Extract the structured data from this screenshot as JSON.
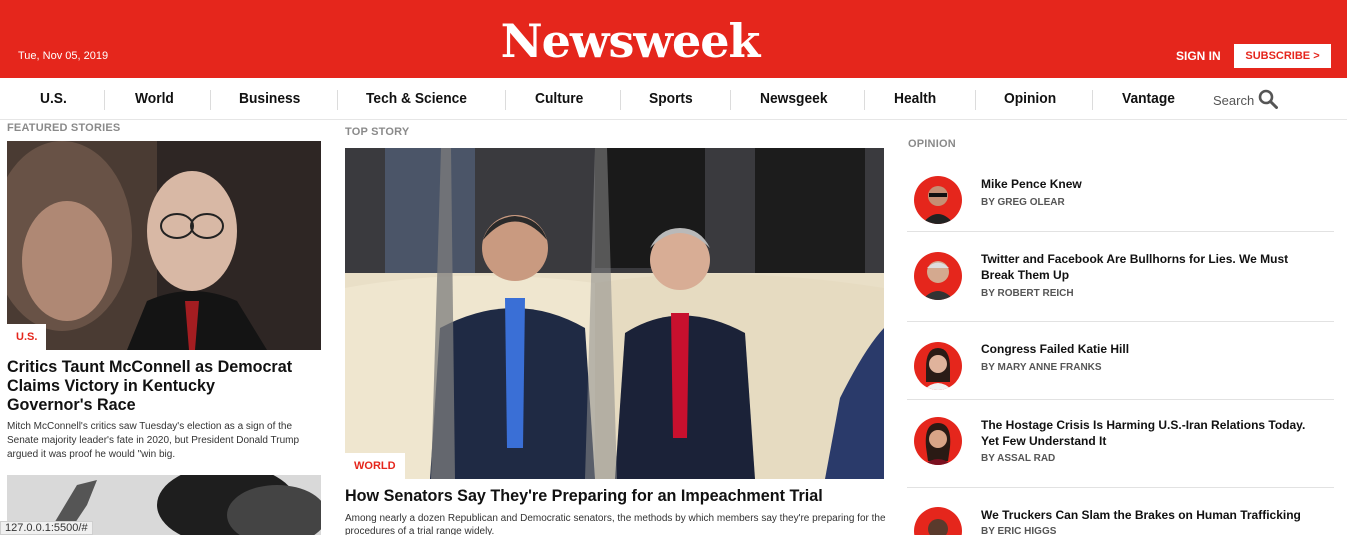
{
  "header": {
    "date": "Tue, Nov 05, 2019",
    "logo": "Newsweek",
    "sign_in": "SIGN IN",
    "subscribe": "SUBSCRIBE >"
  },
  "nav": {
    "items": [
      "U.S.",
      "World",
      "Business",
      "Tech & Science",
      "Culture",
      "Sports",
      "Newsgeek",
      "Health",
      "Opinion",
      "Vantage"
    ],
    "search_label": "Search"
  },
  "featured": {
    "label": "FEATURED STORIES",
    "badge": "U.S.",
    "title": "Critics Taunt McConnell as Democrat Claims Victory in Kentucky Governor's Race",
    "desc": "Mitch McConnell's critics saw Tuesday's election as a sign of the Senate majority leader's fate in 2020, but President Donald Trump argued it was proof he would \"win big."
  },
  "top_story": {
    "label": "TOP STORY",
    "badge": "WORLD",
    "title": "How Senators Say They're Preparing for an Impeachment Trial",
    "desc": "Among nearly a dozen Republican and Democratic senators, the methods by which members say they're preparing for the procedures of a trial range widely."
  },
  "opinion": {
    "label": "OPINION",
    "items": [
      {
        "title": "Mike Pence Knew",
        "author": "BY GREG OLEAR"
      },
      {
        "title": "Twitter and Facebook Are Bullhorns for Lies. We Must Break Them Up",
        "author": "BY ROBERT REICH"
      },
      {
        "title": "Congress Failed Katie Hill",
        "author": "BY MARY ANNE FRANKS"
      },
      {
        "title": "The Hostage Crisis Is Harming U.S.-Iran Relations Today. Yet Few Understand It",
        "author": "BY ASSAL RAD"
      },
      {
        "title": "We Truckers Can Slam the Brakes on Human Trafficking",
        "author": "BY ERIC HIGGS"
      }
    ]
  },
  "status_url": "127.0.0.1:5500/#",
  "colors": {
    "brand": "#e5261c"
  }
}
